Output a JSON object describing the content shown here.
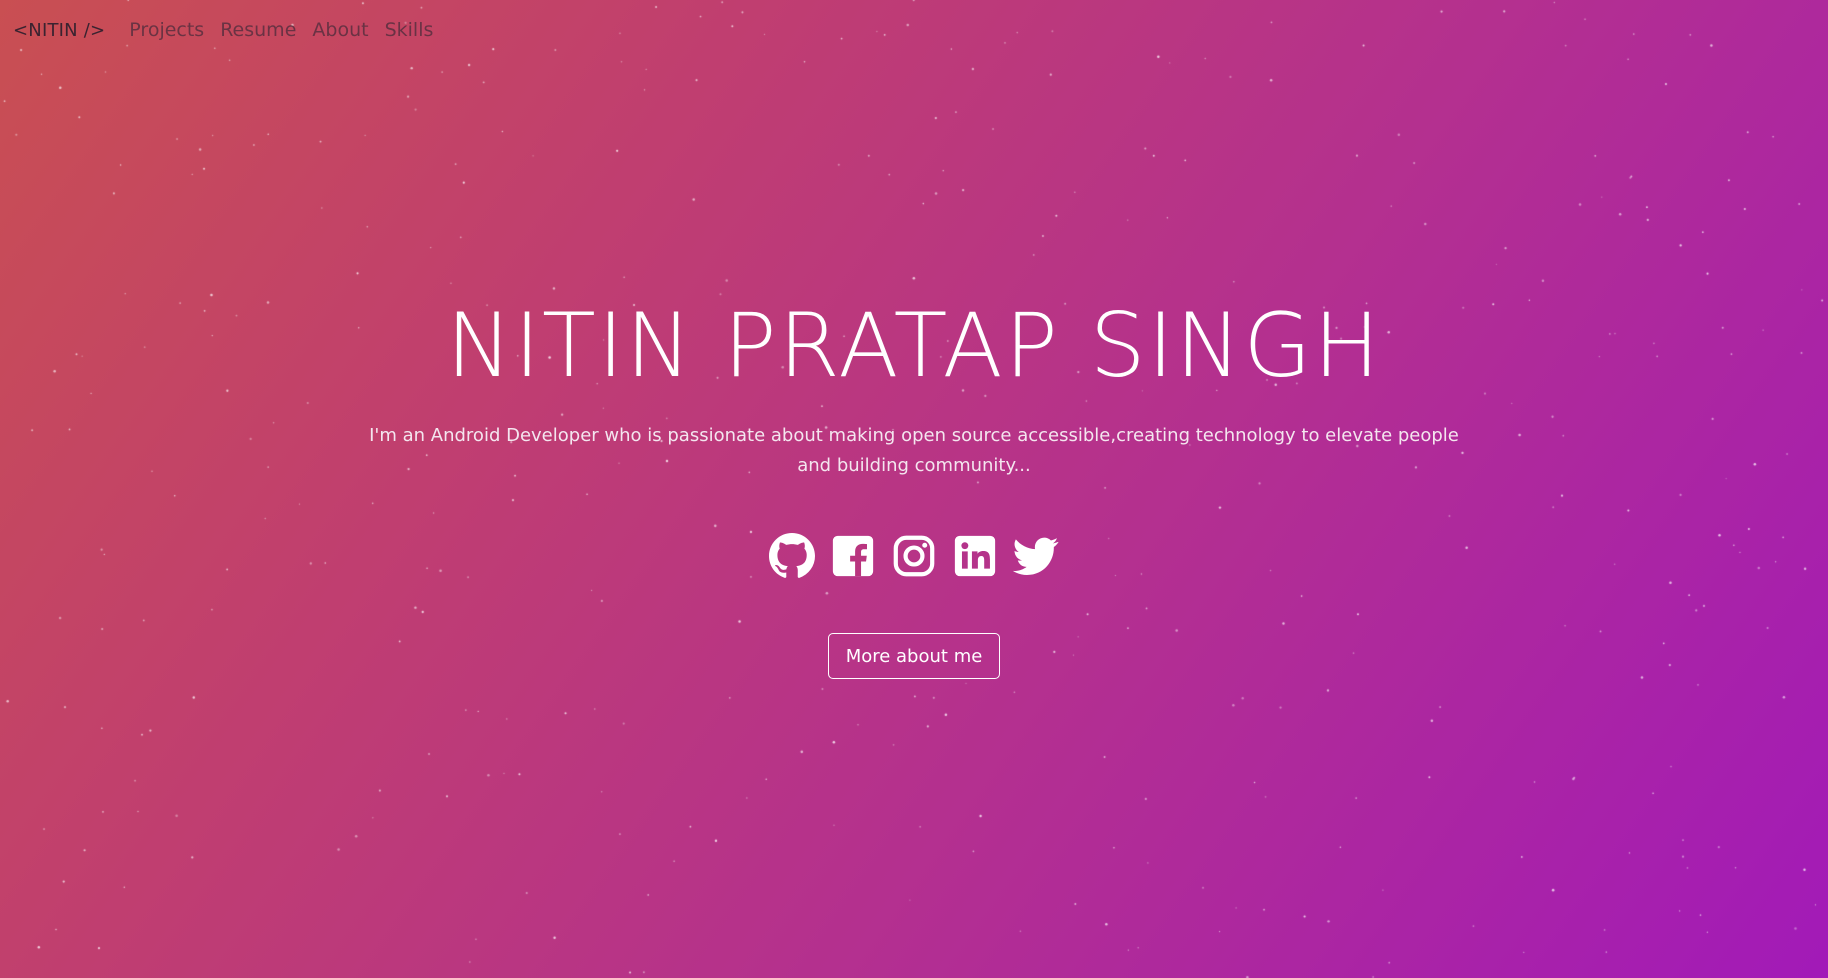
{
  "nav": {
    "brand": "<NITIN />",
    "links": [
      "Projects",
      "Resume",
      "About",
      "Skills"
    ]
  },
  "hero": {
    "title": "NITIN PRATAP SINGH",
    "subtitle": "I'm an Android Developer who is passionate about making open source accessible,creating technology to elevate people and building community...",
    "cta_label": "More about me"
  },
  "socials": [
    {
      "name": "github",
      "icon": "github-icon"
    },
    {
      "name": "facebook",
      "icon": "facebook-icon"
    },
    {
      "name": "instagram",
      "icon": "instagram-icon"
    },
    {
      "name": "linkedin",
      "icon": "linkedin-icon"
    },
    {
      "name": "twitter",
      "icon": "twitter-icon"
    }
  ],
  "colors": {
    "gradient_start": "#c94f52",
    "gradient_end": "#a21ab8",
    "text": "#ffffff",
    "nav_text": "#5a3040"
  }
}
